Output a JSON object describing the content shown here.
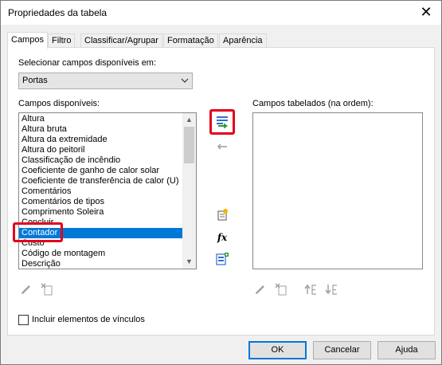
{
  "window": {
    "title": "Propriedades da tabela",
    "close_glyph": "✕"
  },
  "tabs": [
    {
      "label": "Campos",
      "active": true
    },
    {
      "label": "Filtro",
      "active": false
    },
    {
      "label": "Classificar/Agrupar",
      "active": false
    },
    {
      "label": "Formatação",
      "active": false
    },
    {
      "label": "Aparência",
      "active": false
    }
  ],
  "source": {
    "label": "Selecionar campos disponíveis em:",
    "value": "Portas"
  },
  "available": {
    "label": "Campos disponíveis:",
    "items": [
      "Altura",
      "Altura bruta",
      "Altura da extremidade",
      "Altura do peitoril",
      "Classificação de incêndio",
      "Coeficiente de ganho de calor solar",
      "Coeficiente de transferência de calor (U)",
      "Comentários",
      "Comentários de tipos",
      "Comprimento Soleira",
      "Concluir",
      "Contador",
      "Custo",
      "Código de montagem",
      "Descrição"
    ],
    "selected_index": 11
  },
  "scheduled": {
    "label": "Campos tabelados (na ordem):",
    "items": []
  },
  "icons": {
    "add_parameter": "add-parameter-icon",
    "remove_parameter": "remove-parameter-icon",
    "new_parameter": "new-parameter-icon",
    "calculated_value": "calculated-value-icon",
    "combine_parameters": "combine-parameters-icon",
    "edit": "edit-pencil-icon",
    "delete": "delete-parameter-icon",
    "move_up": "move-up-icon",
    "move_down": "move-down-icon"
  },
  "fx_label": "fx",
  "include_links": {
    "label": "Incluir elementos de vínculos",
    "checked": false
  },
  "buttons": {
    "ok": "OK",
    "cancel": "Cancelar",
    "help": "Ajuda"
  },
  "colors": {
    "selection": "#0078d7",
    "highlight": "#e3001b",
    "accent_green": "#2e9b3a"
  }
}
